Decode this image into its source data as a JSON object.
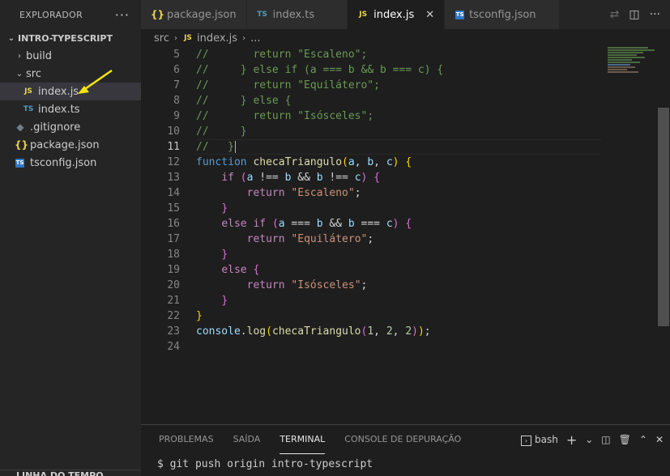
{
  "explorer": {
    "header": "EXPLORADOR",
    "more": "···",
    "project": "INTRO-TYPESCRIPT",
    "items": [
      {
        "label": "build",
        "type": "folder"
      },
      {
        "label": "src",
        "type": "folder"
      },
      {
        "label": "index.js",
        "type": "js",
        "icon_text": "JS"
      },
      {
        "label": "index.ts",
        "type": "ts",
        "icon_text": "TS"
      },
      {
        "label": ".gitignore",
        "type": "git"
      },
      {
        "label": "package.json",
        "type": "json",
        "icon_text": "{}"
      },
      {
        "label": "tsconfig.json",
        "type": "tsconfig",
        "icon_text": "TS"
      }
    ],
    "bottom_section": "LINHA DO TEMPO",
    "annotation_color": "#f5e50a"
  },
  "tabs": [
    {
      "label": "package.json",
      "icon_text": "{}"
    },
    {
      "label": "index.ts",
      "icon_text": "TS"
    },
    {
      "label": "index.js",
      "icon_text": "JS",
      "active": true,
      "close": "✕"
    },
    {
      "label": "tsconfig.json",
      "icon_text": "TS"
    }
  ],
  "breadcrumb": {
    "folder": "src",
    "file_icon": "JS",
    "file": "index.js",
    "more": "..."
  },
  "editor": {
    "current_line": 11,
    "lines": [
      {
        "n": "5"
      },
      {
        "n": "6"
      },
      {
        "n": "7"
      },
      {
        "n": "8"
      },
      {
        "n": "9"
      },
      {
        "n": "10"
      },
      {
        "n": "11"
      },
      {
        "n": "12"
      },
      {
        "n": "13"
      },
      {
        "n": "14"
      },
      {
        "n": "15"
      },
      {
        "n": "16"
      },
      {
        "n": "17"
      },
      {
        "n": "18"
      },
      {
        "n": "19"
      },
      {
        "n": "20"
      },
      {
        "n": "21"
      },
      {
        "n": "22"
      },
      {
        "n": "23"
      },
      {
        "n": "24"
      }
    ],
    "code": {
      "l5": "//       return \"Escaleno\";",
      "l6": "//     } else if (a === b && b === c) {",
      "l7": "//       return \"Equilátero\";",
      "l8": "//     } else {",
      "l9": "//       return \"Isósceles\";",
      "l10": "//     }",
      "l11": "//   }",
      "kw_function": "function",
      "fn_name": "checaTriangulo",
      "p_a": "a",
      "p_b": "b",
      "p_c": "c",
      "kw_if": "if",
      "kw_return": "return",
      "kw_else": "else",
      "s_escaleno": "\"Escaleno\"",
      "s_equilatero": "\"Equilátero\"",
      "s_isosceles": "\"Isósceles\"",
      "console": "console",
      "log": "log",
      "n1": "1",
      "n2": "2",
      "n3": "2"
    }
  },
  "panel": {
    "tabs": [
      "PROBLEMAS",
      "SAÍDA",
      "TERMINAL",
      "CONSOLE DE DEPURAÇÃO"
    ],
    "active_tab": "TERMINAL",
    "shell": "bash",
    "terminal_line": "$ git push origin intro-typescript"
  }
}
